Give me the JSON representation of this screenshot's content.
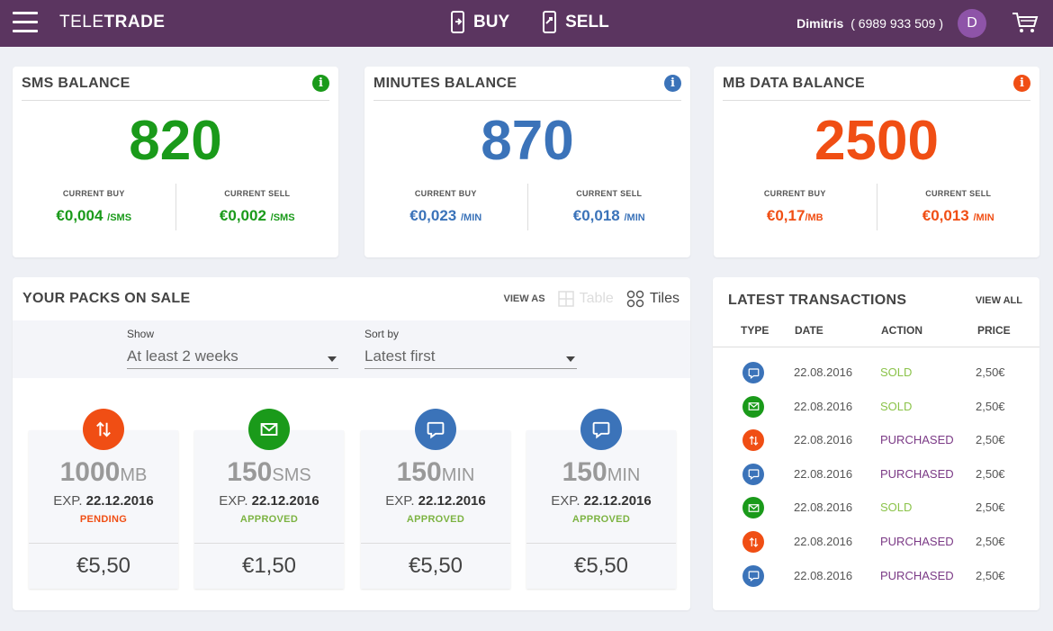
{
  "header": {
    "brand_light": "TELE",
    "brand_bold": "TRADE",
    "buy_label": "BUY",
    "sell_label": "SELL",
    "user_name": "Dimitris",
    "user_phone": "( 6989 933 509 )",
    "avatar_initial": "D"
  },
  "balances": [
    {
      "title": "SMS BALANCE",
      "value": "820",
      "buy_label": "CURRENT BUY",
      "buy_price": "€0,004",
      "buy_unit": "/SMS",
      "sell_label": "CURRENT SELL",
      "sell_price": "€0,002",
      "sell_unit": "/SMS",
      "color": "#1a9a1a",
      "info": "i"
    },
    {
      "title": "MINUTES BALANCE",
      "value": "870",
      "buy_label": "CURRENT BUY",
      "buy_price": "€0,023",
      "buy_unit": "/MIN",
      "sell_label": "CURRENT SELL",
      "sell_price": "€0,018",
      "sell_unit": "/MIN",
      "color": "#3b73b9",
      "info": "i"
    },
    {
      "title": "MB DATA BALANCE",
      "value": "2500",
      "buy_label": "CURRENT BUY",
      "buy_price": "€0,17",
      "buy_unit": "/MB",
      "sell_label": "CURRENT SELL",
      "sell_price": "€0,013",
      "sell_unit": "/MIN",
      "color": "#f04e14",
      "info": "i"
    }
  ],
  "packs": {
    "title": "YOUR PACKS ON SALE",
    "view_as": "VIEW AS",
    "view_table": "Table",
    "view_tiles": "Tiles",
    "show_label": "Show",
    "show_value": "At least 2 weeks",
    "sort_label": "Sort by",
    "sort_value": "Latest first",
    "items": [
      {
        "amount": "1000",
        "unit": "MB",
        "exp_prefix": "EXP.",
        "exp_date": "22.12.2016",
        "status": "PENDING",
        "status_color": "#f04e14",
        "price": "€5,50",
        "icon": "data-arrows-icon",
        "icon_color": "#f04e14"
      },
      {
        "amount": "150",
        "unit": "SMS",
        "exp_prefix": "EXP.",
        "exp_date": "22.12.2016",
        "status": "APPROVED",
        "status_color": "#7cb342",
        "price": "€1,50",
        "icon": "envelope-icon",
        "icon_color": "#1a9a1a"
      },
      {
        "amount": "150",
        "unit": "MIN",
        "exp_prefix": "EXP.",
        "exp_date": "22.12.2016",
        "status": "APPROVED",
        "status_color": "#7cb342",
        "price": "€5,50",
        "icon": "chat-icon",
        "icon_color": "#3b73b9"
      },
      {
        "amount": "150",
        "unit": "MIN",
        "exp_prefix": "EXP.",
        "exp_date": "22.12.2016",
        "status": "APPROVED",
        "status_color": "#7cb342",
        "price": "€5,50",
        "icon": "chat-icon",
        "icon_color": "#3b73b9"
      }
    ]
  },
  "transactions": {
    "title": "LATEST TRANSACTIONS",
    "view_all": "VIEW ALL",
    "columns": [
      "TYPE",
      "DATE",
      "ACTION",
      "PRICE"
    ],
    "rows": [
      {
        "type": "chat-icon",
        "type_color": "#3b73b9",
        "date": "22.08.2016",
        "action": "SOLD",
        "action_color": "#8bc34a",
        "price": "2,50€"
      },
      {
        "type": "envelope-icon",
        "type_color": "#1a9a1a",
        "date": "22.08.2016",
        "action": "SOLD",
        "action_color": "#8bc34a",
        "price": "2,50€"
      },
      {
        "type": "data-arrows-icon",
        "type_color": "#f04e14",
        "date": "22.08.2016",
        "action": "PURCHASED",
        "action_color": "#7b3a86",
        "price": "2,50€"
      },
      {
        "type": "chat-icon",
        "type_color": "#3b73b9",
        "date": "22.08.2016",
        "action": "PURCHASED",
        "action_color": "#7b3a86",
        "price": "2,50€"
      },
      {
        "type": "envelope-icon",
        "type_color": "#1a9a1a",
        "date": "22.08.2016",
        "action": "SOLD",
        "action_color": "#8bc34a",
        "price": "2,50€"
      },
      {
        "type": "data-arrows-icon",
        "type_color": "#f04e14",
        "date": "22.08.2016",
        "action": "PURCHASED",
        "action_color": "#7b3a86",
        "price": "2,50€"
      },
      {
        "type": "chat-icon",
        "type_color": "#3b73b9",
        "date": "22.08.2016",
        "action": "PURCHASED",
        "action_color": "#7b3a86",
        "price": "2,50€"
      }
    ]
  }
}
